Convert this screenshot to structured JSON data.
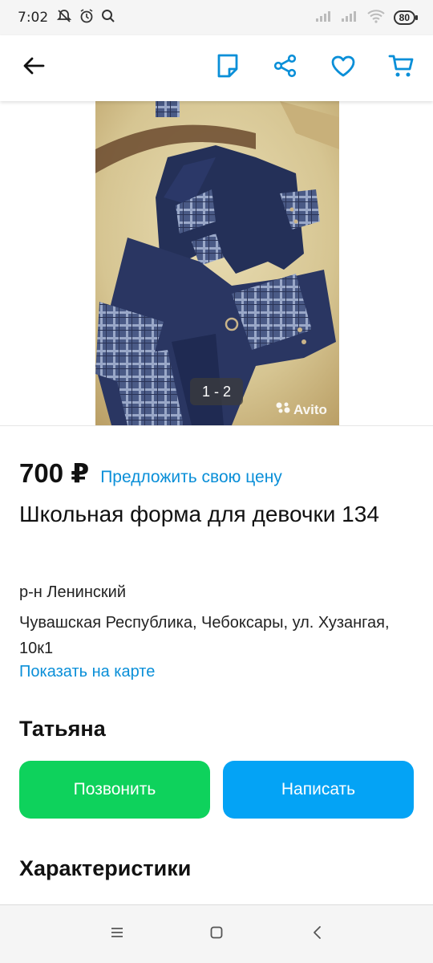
{
  "status_bar": {
    "time": "7:02",
    "battery": "80",
    "left_icons": [
      "muted-bell-icon",
      "alarm-icon",
      "search-icon"
    ],
    "right_icons": [
      "signal-icon",
      "signal-icon",
      "wifi-icon",
      "battery-icon"
    ]
  },
  "app_bar": {
    "back_icon": "arrow-left-icon",
    "actions": [
      "note-icon",
      "share-icon",
      "heart-icon",
      "cart-icon"
    ],
    "accent_color": "#0a8fd8"
  },
  "gallery": {
    "counter": "1 - 2",
    "watermark": "Avito"
  },
  "listing": {
    "price": "700 ₽",
    "offer_link": "Предложить свою цену",
    "title": "Школьная форма для девочки 134",
    "district": "р-н Ленинский",
    "address": "Чувашская Республика, Чебоксары, ул. Хузангая, 10к1",
    "map_link": "Показать на карте"
  },
  "seller": {
    "name": "Татьяна",
    "call_label": "Позвонить",
    "write_label": "Написать",
    "call_color": "#0ed25c",
    "write_color": "#04a3f5"
  },
  "sections": {
    "characteristics": "Характеристики"
  },
  "nav_bar": {
    "buttons": [
      "menu-icon",
      "home-square-icon",
      "back-chevron-icon"
    ]
  }
}
